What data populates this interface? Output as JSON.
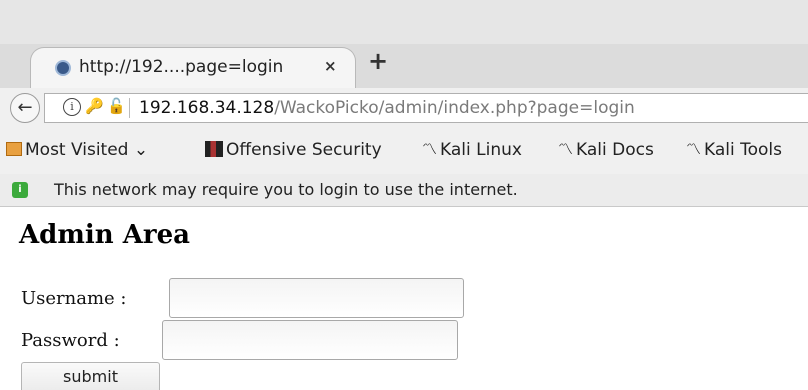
{
  "browser": {
    "tab": {
      "title": "http://192....page=login",
      "close_label": "×"
    },
    "new_tab_label": "+",
    "back_label": "←",
    "url": {
      "host": "192.168.34.128",
      "path": "/WackoPicko/admin/index.php?page=login"
    },
    "bookmarks": [
      {
        "label": "Most Visited",
        "icon": "folder-icon",
        "has_dropdown": true
      },
      {
        "label": "Offensive Security",
        "icon": "offsec-icon"
      },
      {
        "label": "Kali Linux",
        "icon": "kali-dragon-icon"
      },
      {
        "label": "Kali Docs",
        "icon": "kali-dragon-icon"
      },
      {
        "label": "Kali Tools",
        "icon": "kali-dragon-icon"
      }
    ],
    "notification": "This network may require you to login to use the internet."
  },
  "page": {
    "heading": "Admin Area",
    "form": {
      "username_label": "Username :",
      "username_value": "",
      "password_label": "Password :",
      "password_value": "",
      "submit_label": "submit"
    }
  }
}
